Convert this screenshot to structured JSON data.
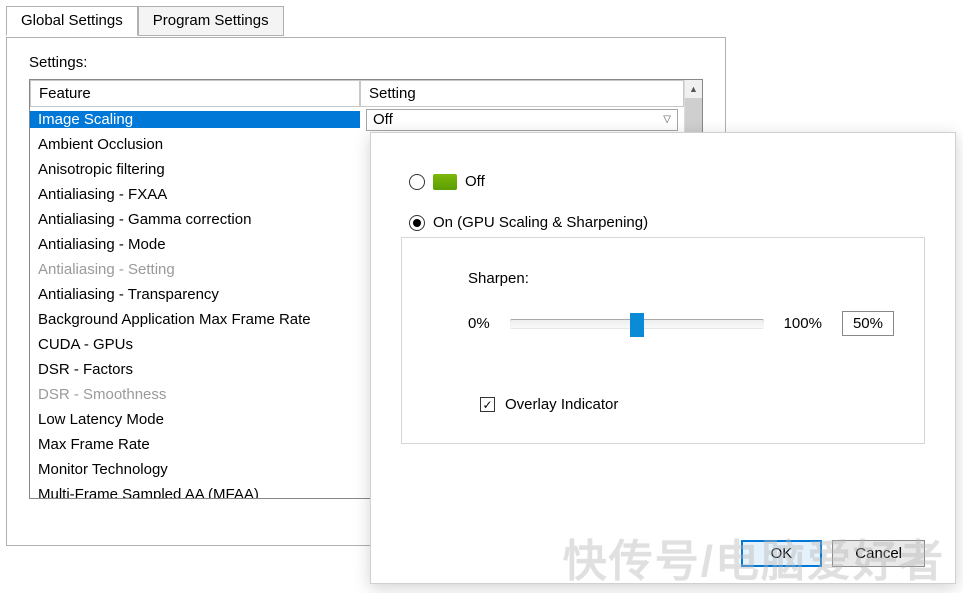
{
  "tabs": {
    "global": "Global Settings",
    "program": "Program Settings"
  },
  "settings_label": "Settings:",
  "columns": {
    "feature": "Feature",
    "setting": "Setting"
  },
  "selected_value": "Off",
  "features": [
    {
      "name": "Image Scaling",
      "selected": true,
      "disabled": false
    },
    {
      "name": "Ambient Occlusion",
      "selected": false,
      "disabled": false
    },
    {
      "name": "Anisotropic filtering",
      "selected": false,
      "disabled": false
    },
    {
      "name": "Antialiasing - FXAA",
      "selected": false,
      "disabled": false
    },
    {
      "name": "Antialiasing - Gamma correction",
      "selected": false,
      "disabled": false
    },
    {
      "name": "Antialiasing - Mode",
      "selected": false,
      "disabled": false
    },
    {
      "name": "Antialiasing - Setting",
      "selected": false,
      "disabled": true
    },
    {
      "name": "Antialiasing - Transparency",
      "selected": false,
      "disabled": false
    },
    {
      "name": "Background Application Max Frame Rate",
      "selected": false,
      "disabled": false
    },
    {
      "name": "CUDA - GPUs",
      "selected": false,
      "disabled": false
    },
    {
      "name": "DSR - Factors",
      "selected": false,
      "disabled": false
    },
    {
      "name": "DSR - Smoothness",
      "selected": false,
      "disabled": true
    },
    {
      "name": "Low Latency Mode",
      "selected": false,
      "disabled": false
    },
    {
      "name": "Max Frame Rate",
      "selected": false,
      "disabled": false
    },
    {
      "name": "Monitor Technology",
      "selected": false,
      "disabled": false
    },
    {
      "name": "Multi-Frame Sampled AA (MFAA)",
      "selected": false,
      "disabled": false
    }
  ],
  "popup": {
    "off_label": "Off",
    "on_label": "On (GPU Scaling & Sharpening)",
    "sharpen_label": "Sharpen:",
    "min_label": "0%",
    "max_label": "100%",
    "value_label": "50%",
    "overlay_label": "Overlay Indicator",
    "ok_label": "OK",
    "cancel_label": "Cancel"
  },
  "watermark": "快传号/电脑爱好者"
}
